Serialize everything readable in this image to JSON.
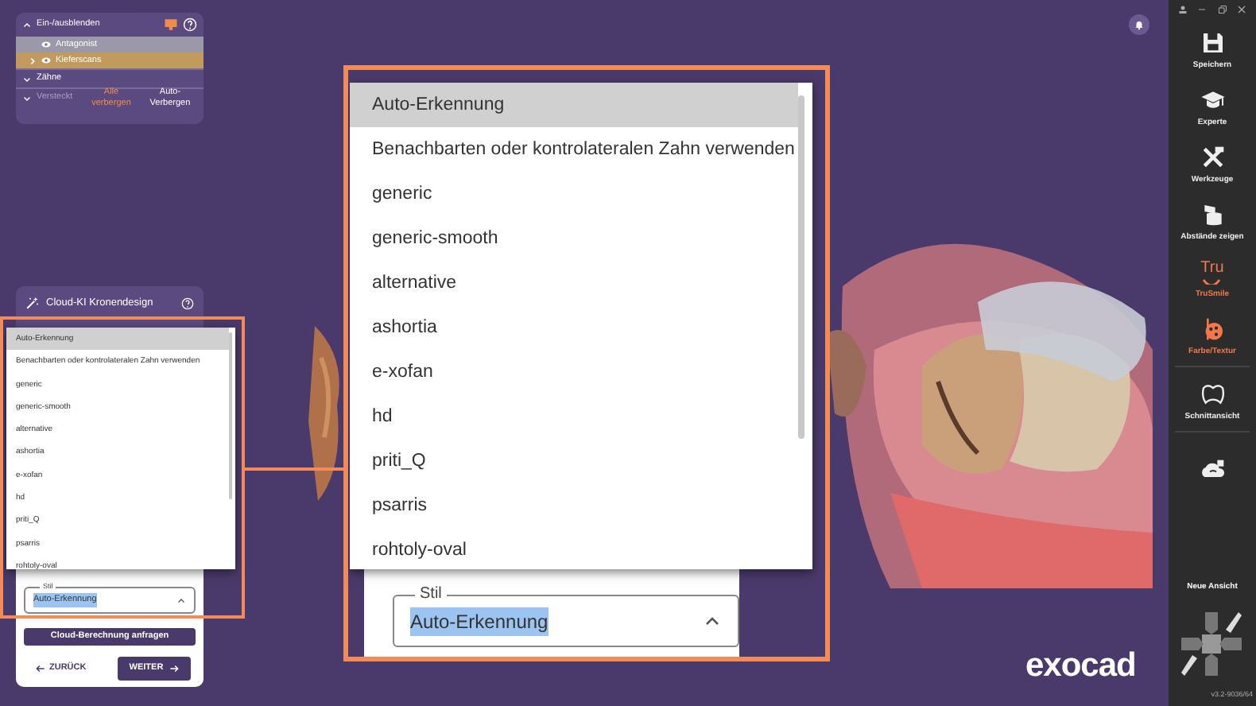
{
  "visibility_panel": {
    "title": "Ein-/ausblenden",
    "expanded": true,
    "items": [
      {
        "label": "Antagonist",
        "selected": false
      },
      {
        "label": "Kieferscans",
        "selected": true
      }
    ],
    "groups": [
      {
        "label": "Zähne"
      },
      {
        "label": "Versteckt"
      }
    ],
    "buttons": [
      {
        "label": "Alle verbergen",
        "highlighted": true
      },
      {
        "label": "Auto-Verbergen",
        "highlighted": false
      }
    ]
  },
  "design_panel": {
    "title": "Cloud-KI Kronendesign",
    "style_label": "Stil",
    "style_value": "Auto-Erkennung",
    "request_button": "Cloud-Berechnung anfragen",
    "back_button": "ZURÜCK",
    "next_button": "WEITER",
    "options": [
      {
        "label": "Auto-Erkennung",
        "selected": true
      },
      {
        "label": "Benachbarten oder kontrolateralen Zahn verwenden",
        "selected": false
      },
      {
        "label": "generic",
        "selected": false
      },
      {
        "label": "generic-smooth",
        "selected": false
      },
      {
        "label": "alternative",
        "selected": false
      },
      {
        "label": "ashortia",
        "selected": false
      },
      {
        "label": "e-xofan",
        "selected": false
      },
      {
        "label": "hd",
        "selected": false
      },
      {
        "label": "priti_Q",
        "selected": false
      },
      {
        "label": "psarris",
        "selected": false
      },
      {
        "label": "rohtoly-oval",
        "selected": false
      }
    ]
  },
  "zoom_inset": {
    "style_label": "Stil",
    "style_value": "Auto-Erkennung",
    "options": [
      {
        "label": "Auto-Erkennung",
        "selected": true
      },
      {
        "label": "Benachbarten oder kontrolateralen Zahn verwenden",
        "selected": false
      },
      {
        "label": "generic",
        "selected": false
      },
      {
        "label": "generic-smooth",
        "selected": false
      },
      {
        "label": "alternative",
        "selected": false
      },
      {
        "label": "ashortia",
        "selected": false
      },
      {
        "label": "e-xofan",
        "selected": false
      },
      {
        "label": "hd",
        "selected": false
      },
      {
        "label": "priti_Q",
        "selected": false
      },
      {
        "label": "psarris",
        "selected": false
      },
      {
        "label": "rohtoly-oval",
        "selected": false
      }
    ]
  },
  "toolbar": {
    "items": [
      {
        "label": "Speichern",
        "highlighted": false
      },
      {
        "label": "Experte",
        "highlighted": false
      },
      {
        "label": "Werkzeuge",
        "highlighted": false
      },
      {
        "label": "Abstände zeigen",
        "highlighted": false
      },
      {
        "label": "TruSmile",
        "highlighted": true,
        "icon_text": "Tru"
      },
      {
        "label": "Farbe/Textur",
        "highlighted": true
      },
      {
        "label": "Schnittansicht",
        "highlighted": false
      },
      {
        "highlighted": false
      }
    ],
    "view_label": "Neue Ansicht",
    "version": "v3.2-9036/64"
  },
  "logo": "exocad"
}
